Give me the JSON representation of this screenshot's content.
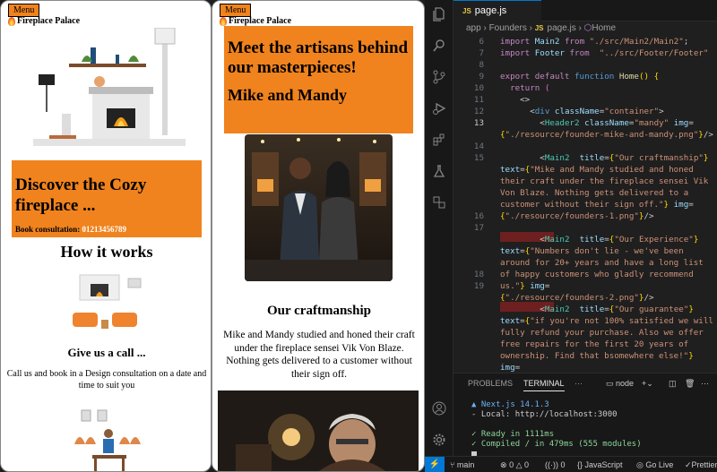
{
  "site": {
    "menu_label": "Menu",
    "brand": "Fireplace Palace"
  },
  "page1": {
    "hero_title": "Discover the Cozy fireplace ...",
    "consult_label": "Book consultation:",
    "consult_number": "01213456789",
    "how_title": "How it works",
    "step1_title": "Give us a call ...",
    "step1_text": "Call us and book in a Design consultation on a date and time to suit you"
  },
  "page2": {
    "hero_title": "Meet the artisans behind our masterpieces!",
    "founders": "Mike and Mandy",
    "section_title": "Our craftmanship",
    "section_text": "Mike and Mandy studied and honed their craft under the fireplace sensei Vik Von Blaze. Nothing gets delivered to a customer without their sign off."
  },
  "editor": {
    "tab_label": "page.js",
    "tab_badge": "JS",
    "breadcrumb": [
      "app",
      "Founders",
      "page.js",
      "Home"
    ],
    "line_numbers": [
      "6",
      "7",
      "8",
      "9",
      "10",
      "11",
      "12",
      "13",
      "",
      "14",
      "15",
      "",
      "",
      "",
      "",
      "16",
      "17",
      "",
      "",
      "",
      "18",
      "19",
      "",
      ""
    ],
    "panel_tabs": [
      "PROBLEMS",
      "TERMINAL"
    ],
    "terminal_shell": "node",
    "terminal_lines": [
      "▲ Next.js 14.1.3",
      "- Local:        http://localhost:3000",
      "",
      "✓ Ready in 1111ms",
      "✓ Compiled / in 479ms (555 modules)"
    ],
    "status": {
      "branch": "main",
      "errors": "0",
      "warnings": "0",
      "ports": "0",
      "language": "JavaScript",
      "golive": "Go Live",
      "prettier": "Prettier"
    }
  },
  "colors": {
    "accent_orange": "#f0831e",
    "editor_bg": "#1f1f1f",
    "status_blue": "#0078d4"
  }
}
